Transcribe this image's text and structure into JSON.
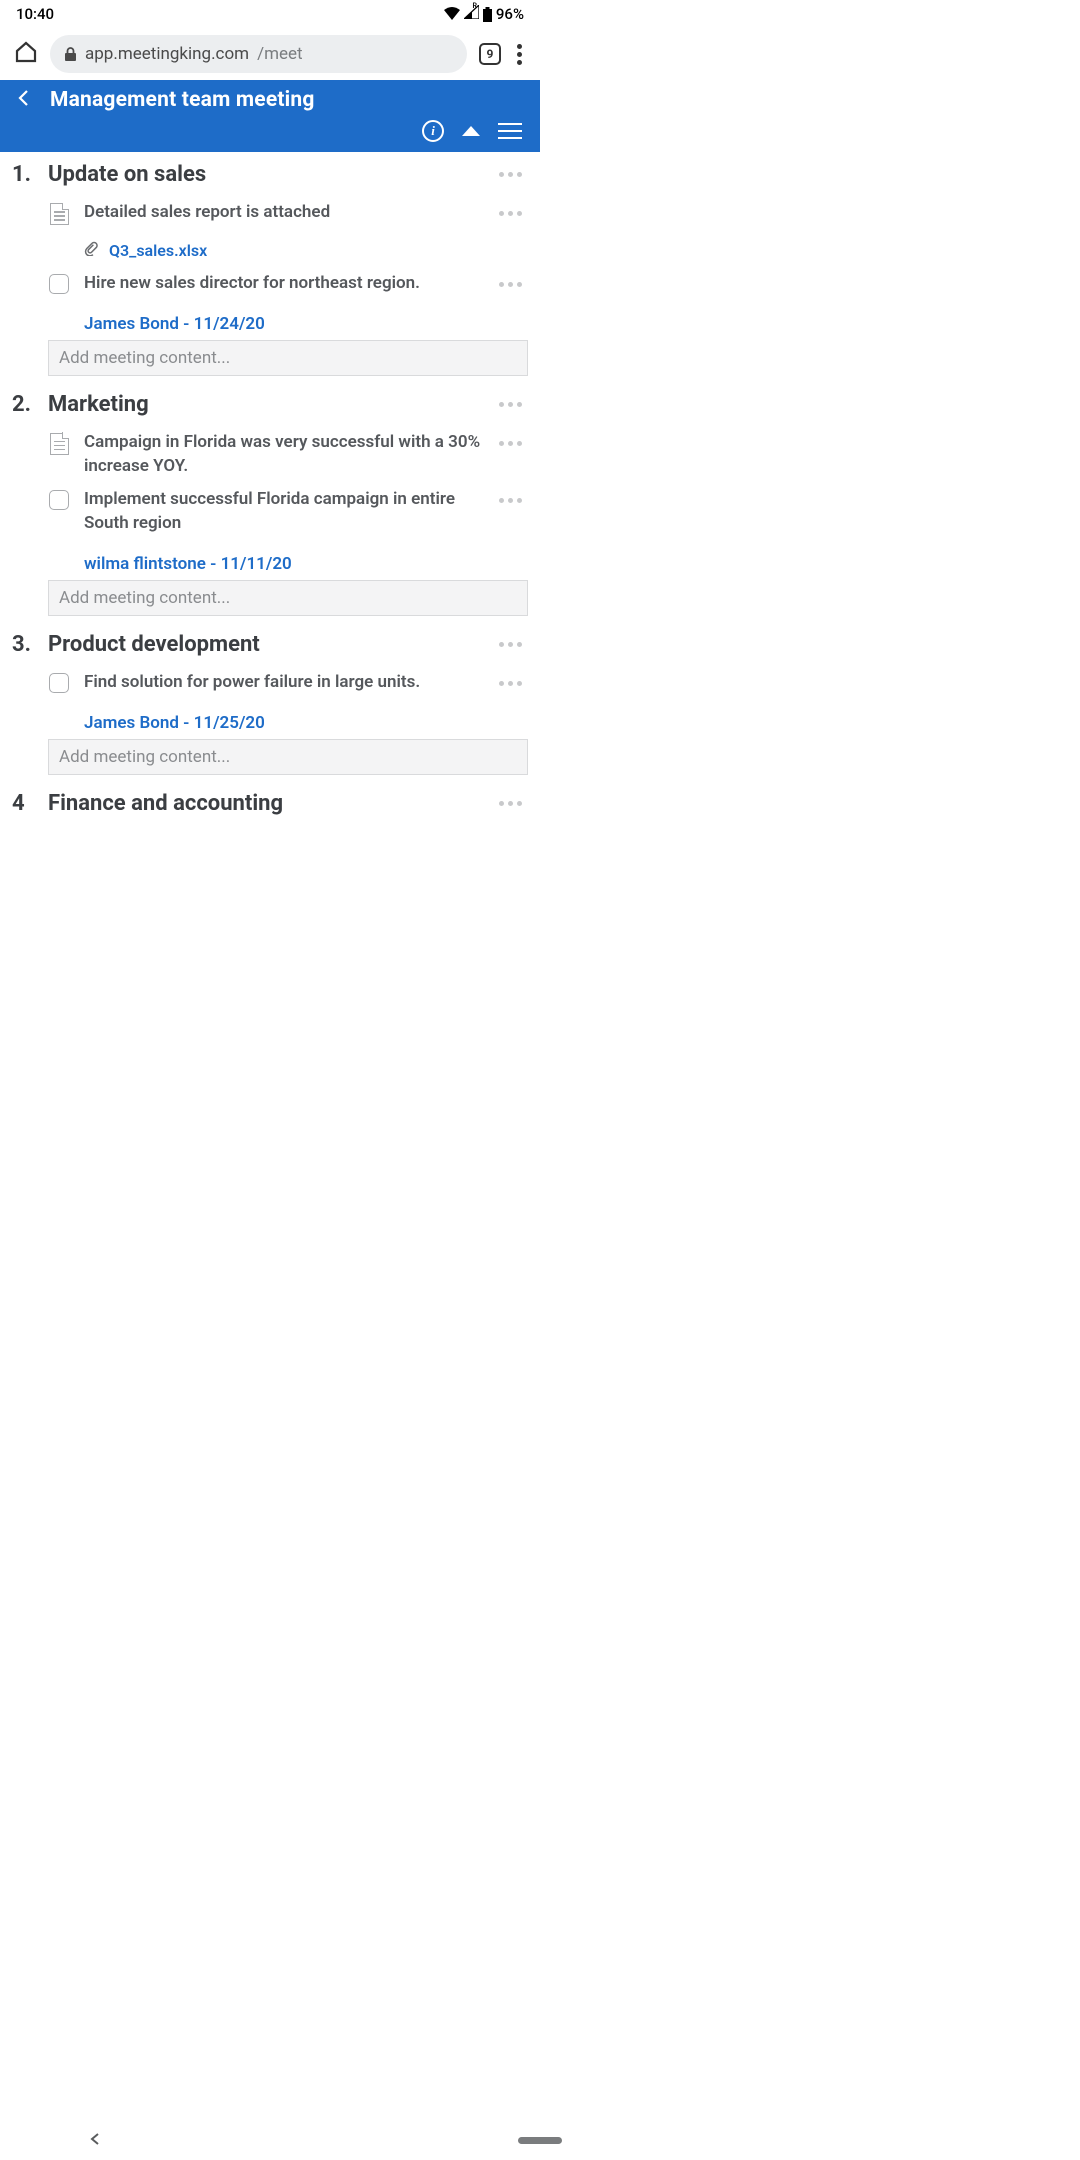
{
  "status": {
    "time": "10:40",
    "battery": "96%",
    "roaming": "R"
  },
  "browser": {
    "url_host": "app.meetingking.com",
    "url_path": "/meet",
    "tab_count": "9"
  },
  "header": {
    "title": "Management team meeting"
  },
  "add_placeholder": "Add meeting content...",
  "agenda": [
    {
      "num": "1.",
      "title": "Update on sales",
      "items": [
        {
          "kind": "note",
          "text": "Detailed sales report is attached",
          "attachment": "Q3_sales.xlsx"
        },
        {
          "kind": "task",
          "text": "Hire new sales director for northeast region.",
          "assignee": "James Bond - 11/24/20"
        }
      ]
    },
    {
      "num": "2.",
      "title": "Marketing",
      "items": [
        {
          "kind": "note",
          "text": "Campaign in Florida was very successful with a 30% increase YOY."
        },
        {
          "kind": "task",
          "text": "Implement successful Florida campaign in entire South region",
          "assignee": "wilma flintstone - 11/11/20"
        }
      ]
    },
    {
      "num": "3.",
      "title": "Product development",
      "items": [
        {
          "kind": "task",
          "text": "Find solution for power failure in large units.",
          "assignee": "James Bond - 11/25/20"
        }
      ]
    },
    {
      "num": "4",
      "title": "Finance and accounting",
      "items": []
    }
  ]
}
